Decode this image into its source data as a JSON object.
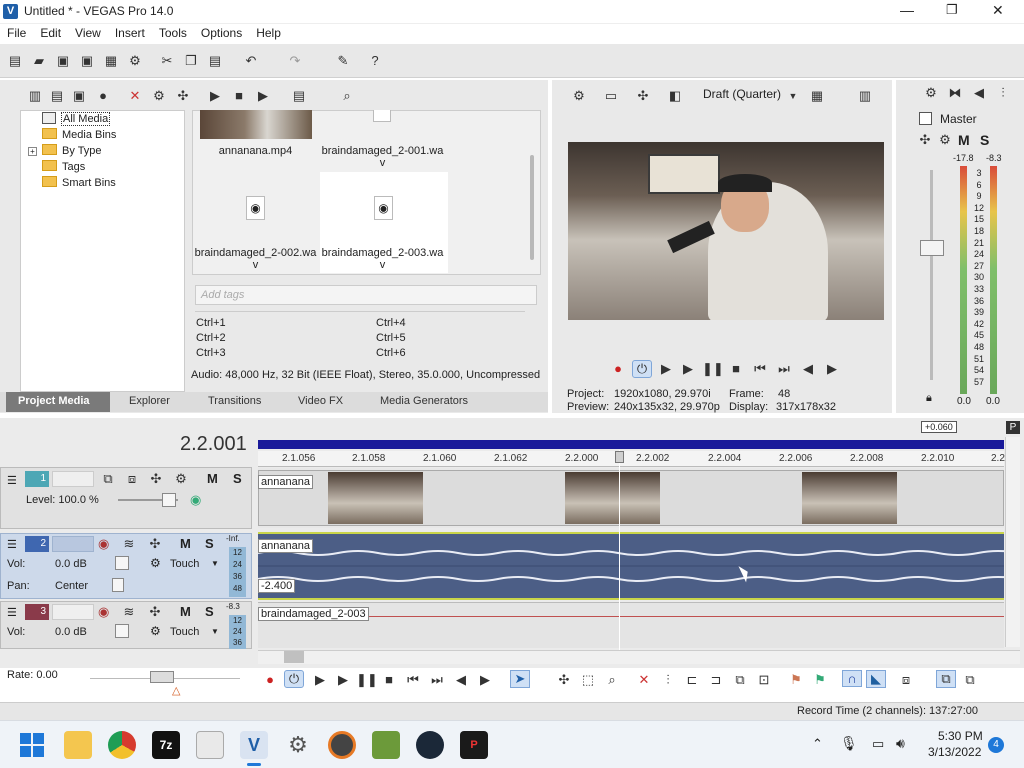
{
  "window": {
    "title": "Untitled * - VEGAS Pro 14.0",
    "controls": {
      "minimize": "—",
      "maximize": "❐",
      "close": "✕"
    }
  },
  "menu": [
    "File",
    "Edit",
    "View",
    "Insert",
    "Tools",
    "Options",
    "Help"
  ],
  "project_media": {
    "tree": [
      "All Media",
      "Media Bins",
      "By Type",
      "Tags",
      "Smart Bins"
    ],
    "tree_expander": "+",
    "files": [
      "annanana.mp4",
      "braindamaged_2-001.wav",
      "braindamaged_2-002.wav",
      "braindamaged_2-003.wav"
    ],
    "tags_placeholder": "Add tags",
    "shortcuts": [
      "Ctrl+1",
      "Ctrl+4",
      "Ctrl+2",
      "Ctrl+5",
      "Ctrl+3",
      "Ctrl+6"
    ],
    "info": "Audio: 48,000 Hz, 32 Bit (IEEE Float), Stereo, 35.0.000, Uncompressed"
  },
  "tabs": [
    "Project Media",
    "Explorer",
    "Transitions",
    "Video FX",
    "Media Generators"
  ],
  "preview": {
    "quality": "Draft (Quarter)",
    "project_label": "Project:",
    "project_value": "1920x1080, 29.970i",
    "preview_label": "Preview:",
    "preview_value": "240x135x32, 29.970p",
    "frame_label": "Frame:",
    "frame_value": "48",
    "display_label": "Display:",
    "display_value": "317x178x32"
  },
  "master": {
    "title": "Master",
    "m": "M",
    "s": "S",
    "peak_left": "-17.8",
    "peak_right": "-8.3",
    "scale": [
      "3",
      "6",
      "9",
      "12",
      "15",
      "18",
      "21",
      "24",
      "27",
      "30",
      "33",
      "36",
      "39",
      "42",
      "45",
      "48",
      "51",
      "54",
      "57"
    ],
    "bottom_left": "0.0",
    "bottom_right": "0.0"
  },
  "timeline": {
    "timecode": "2.2.001",
    "offset_badge": "+0.060",
    "ruler": [
      "2.1.056",
      "2.1.058",
      "2.1.060",
      "2.1.062",
      "2.2.000",
      "2.2.002",
      "2.2.004",
      "2.2.006",
      "2.2.008",
      "2.2.010",
      "2.2"
    ],
    "tracks": [
      {
        "num": "1",
        "level": "Level: 100.0 %",
        "clip": "annanana",
        "m": "M",
        "s": "S"
      },
      {
        "num": "2",
        "vol_label": "Vol:",
        "vol": "0.0 dB",
        "pan_label": "Pan:",
        "pan": "Center",
        "touch": "Touch",
        "clip": "annanana",
        "level_text": "-2.400",
        "meter_top": "-Inf.",
        "meter_scale": [
          "12",
          "24",
          "36",
          "48"
        ],
        "m": "M",
        "s": "S"
      },
      {
        "num": "3",
        "vol_label": "Vol:",
        "vol": "0.0 dB",
        "touch": "Touch",
        "clip": "braindamaged_2-003",
        "meter_top": "-8.3",
        "meter_scale": [
          "12",
          "24",
          "36"
        ],
        "m": "M",
        "s": "S"
      }
    ],
    "rate": "Rate: 0.00"
  },
  "status_bar": "Record Time (2 channels): 137:27:00",
  "taskbar": {
    "time": "5:30 PM",
    "date": "3/13/2022",
    "notification_count": "4"
  }
}
